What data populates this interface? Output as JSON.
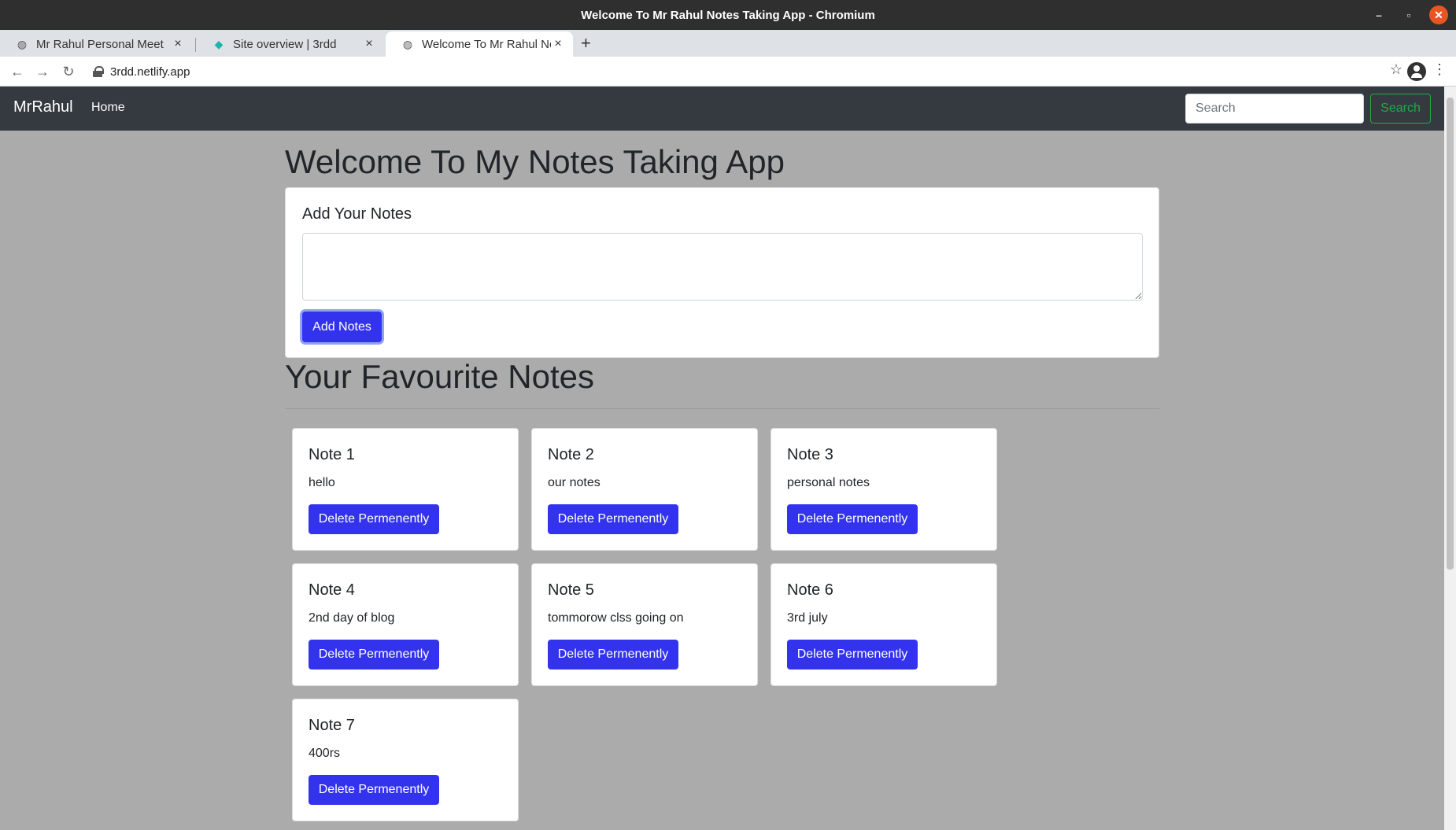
{
  "window": {
    "title": "Welcome To Mr Rahul Notes Taking App - Chromium"
  },
  "tabs": [
    {
      "label": "Mr Rahul Personal Meet",
      "icon": "globe-icon"
    },
    {
      "label": "Site overview | 3rdd",
      "icon": "netlify-icon"
    },
    {
      "label": "Welcome To Mr Rahul No",
      "icon": "globe-icon"
    }
  ],
  "browser": {
    "url": "3rdd.netlify.app"
  },
  "navbar": {
    "brand": "MrRahul",
    "home": "Home",
    "search_placeholder": "Search",
    "search_button": "Search"
  },
  "main": {
    "title": "Welcome To My Notes Taking App",
    "add_card_title": "Add Your Notes",
    "add_button": "Add Notes",
    "favourites_title": "Your Favourite Notes"
  },
  "notes": [
    {
      "title": "Note 1",
      "text": "hello",
      "button": "Delete Permenently"
    },
    {
      "title": "Note 2",
      "text": "our notes",
      "button": "Delete Permenently"
    },
    {
      "title": "Note 3",
      "text": "personal notes",
      "button": "Delete Permenently"
    },
    {
      "title": "Note 4",
      "text": "2nd day of blog",
      "button": "Delete Permenently"
    },
    {
      "title": "Note 5",
      "text": "tommorow clss going on",
      "button": "Delete Permenently"
    },
    {
      "title": "Note 6",
      "text": "3rd july",
      "button": "Delete Permenently"
    },
    {
      "title": "Note 7",
      "text": "400rs",
      "button": "Delete Permenently"
    }
  ],
  "colors": {
    "navbar": "#343a40",
    "primary_button": "#3333ee",
    "search_button": "#28a745",
    "page_background": "#ababab"
  }
}
